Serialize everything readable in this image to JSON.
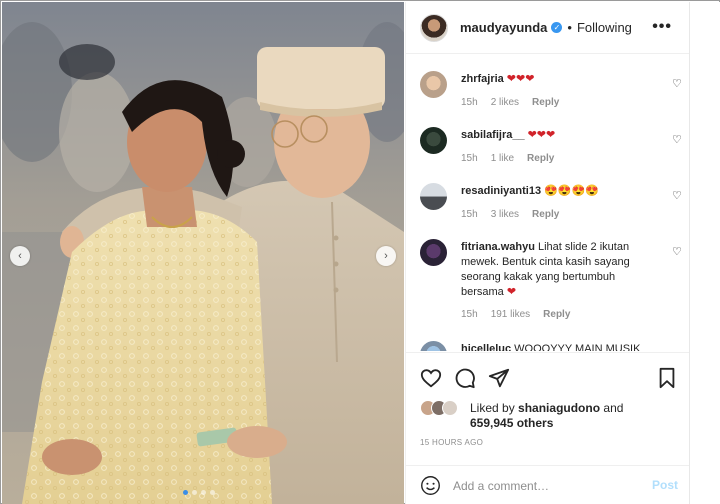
{
  "post": {
    "username": "maudyayunda",
    "separator": "•",
    "follow_label": "Following",
    "more_label": "•••",
    "nav_prev": "‹",
    "nav_next": "›",
    "slide_count": 4,
    "active_slide": 1
  },
  "comments": [
    {
      "username": "zhrfajria",
      "text": "",
      "hearts": "❤❤❤",
      "time": "15h",
      "likes": "2 likes",
      "reply": "Reply"
    },
    {
      "username": "sabilafijra__",
      "text": "",
      "hearts": "❤❤❤",
      "time": "15h",
      "likes": "1 like",
      "reply": "Reply"
    },
    {
      "username": "resadiniyanti13",
      "text": "😍😍😍😍",
      "hearts": "",
      "time": "15h",
      "likes": "3 likes",
      "reply": "Reply"
    },
    {
      "username": "fitriana.wahyu",
      "text": "Lihat slide 2 ikutan mewek. Bentuk cinta kasih sayang seorang kakak yang bertumbuh bersama",
      "hearts": "❤",
      "time": "15h",
      "likes": "191 likes",
      "reply": "Reply"
    },
    {
      "username": "hicelleluc",
      "text": "WOOOYYY MAIN MUSIK",
      "hearts": "",
      "time": "",
      "likes": "",
      "reply": ""
    }
  ],
  "likes": {
    "prefix": "Liked by",
    "user": "shaniagudono",
    "and": "and",
    "count": "659,945 others"
  },
  "timestamp": "15 HOURS AGO",
  "add_comment": {
    "placeholder": "Add a comment…",
    "post_label": "Post"
  },
  "colors": {
    "heart": "#d1232a",
    "verified": "#3897f0",
    "post_disabled": "#b2dffc",
    "active_dot": "#3a8ee6"
  }
}
